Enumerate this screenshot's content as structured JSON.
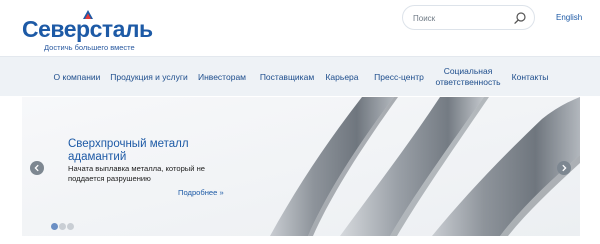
{
  "header": {
    "logo_text": "Северсталь",
    "tagline": "Достичь большего вместе",
    "search_placeholder": "Поиск",
    "lang_label": "English"
  },
  "nav": {
    "items": [
      {
        "label": "О компании"
      },
      {
        "label": "Продукция и услуги"
      },
      {
        "label": "Инвесторам"
      },
      {
        "label": "Поставщикам"
      },
      {
        "label": "Карьера"
      },
      {
        "label": "Пресс-центр"
      },
      {
        "label": "Социальная ответственность"
      },
      {
        "label": "Контакты"
      }
    ]
  },
  "banner": {
    "title": "Сверхпрочный металл адамантий",
    "text": "Начата выплавка металла, который не поддается разрушению",
    "link_label": "Подробнее »"
  },
  "slider": {
    "slide_count": 3,
    "active_index": 0
  },
  "colors": {
    "brand_blue": "#1d5aa6",
    "nav_bg": "#eef2f6",
    "arrow_bg": "#7d8791",
    "dot_active": "#6b8fc4",
    "dot_inactive": "#c9ced4"
  },
  "icons": {
    "logo_mark": "severstal-logo-mark-icon",
    "search": "search-icon",
    "prev": "chevron-left-icon",
    "next": "chevron-right-icon"
  }
}
